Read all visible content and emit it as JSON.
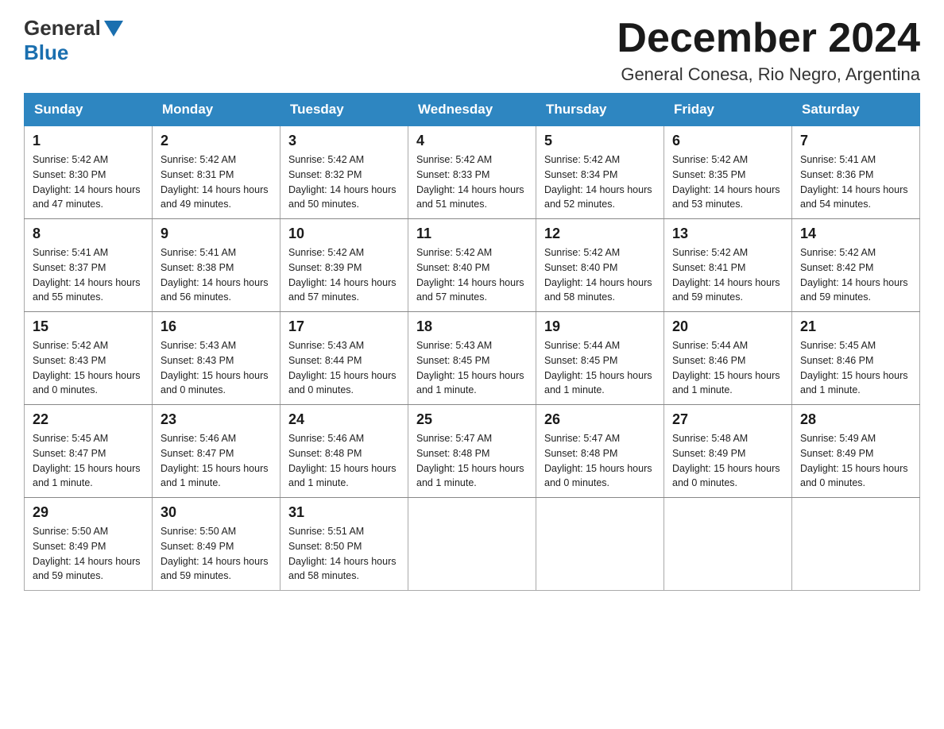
{
  "header": {
    "logo_general": "General",
    "logo_blue": "Blue",
    "title": "December 2024",
    "subtitle": "General Conesa, Rio Negro, Argentina"
  },
  "weekdays": [
    "Sunday",
    "Monday",
    "Tuesday",
    "Wednesday",
    "Thursday",
    "Friday",
    "Saturday"
  ],
  "weeks": [
    [
      {
        "day": "1",
        "sunrise": "5:42 AM",
        "sunset": "8:30 PM",
        "daylight": "14 hours and 47 minutes."
      },
      {
        "day": "2",
        "sunrise": "5:42 AM",
        "sunset": "8:31 PM",
        "daylight": "14 hours and 49 minutes."
      },
      {
        "day": "3",
        "sunrise": "5:42 AM",
        "sunset": "8:32 PM",
        "daylight": "14 hours and 50 minutes."
      },
      {
        "day": "4",
        "sunrise": "5:42 AM",
        "sunset": "8:33 PM",
        "daylight": "14 hours and 51 minutes."
      },
      {
        "day": "5",
        "sunrise": "5:42 AM",
        "sunset": "8:34 PM",
        "daylight": "14 hours and 52 minutes."
      },
      {
        "day": "6",
        "sunrise": "5:42 AM",
        "sunset": "8:35 PM",
        "daylight": "14 hours and 53 minutes."
      },
      {
        "day": "7",
        "sunrise": "5:41 AM",
        "sunset": "8:36 PM",
        "daylight": "14 hours and 54 minutes."
      }
    ],
    [
      {
        "day": "8",
        "sunrise": "5:41 AM",
        "sunset": "8:37 PM",
        "daylight": "14 hours and 55 minutes."
      },
      {
        "day": "9",
        "sunrise": "5:41 AM",
        "sunset": "8:38 PM",
        "daylight": "14 hours and 56 minutes."
      },
      {
        "day": "10",
        "sunrise": "5:42 AM",
        "sunset": "8:39 PM",
        "daylight": "14 hours and 57 minutes."
      },
      {
        "day": "11",
        "sunrise": "5:42 AM",
        "sunset": "8:40 PM",
        "daylight": "14 hours and 57 minutes."
      },
      {
        "day": "12",
        "sunrise": "5:42 AM",
        "sunset": "8:40 PM",
        "daylight": "14 hours and 58 minutes."
      },
      {
        "day": "13",
        "sunrise": "5:42 AM",
        "sunset": "8:41 PM",
        "daylight": "14 hours and 59 minutes."
      },
      {
        "day": "14",
        "sunrise": "5:42 AM",
        "sunset": "8:42 PM",
        "daylight": "14 hours and 59 minutes."
      }
    ],
    [
      {
        "day": "15",
        "sunrise": "5:42 AM",
        "sunset": "8:43 PM",
        "daylight": "15 hours and 0 minutes."
      },
      {
        "day": "16",
        "sunrise": "5:43 AM",
        "sunset": "8:43 PM",
        "daylight": "15 hours and 0 minutes."
      },
      {
        "day": "17",
        "sunrise": "5:43 AM",
        "sunset": "8:44 PM",
        "daylight": "15 hours and 0 minutes."
      },
      {
        "day": "18",
        "sunrise": "5:43 AM",
        "sunset": "8:45 PM",
        "daylight": "15 hours and 1 minute."
      },
      {
        "day": "19",
        "sunrise": "5:44 AM",
        "sunset": "8:45 PM",
        "daylight": "15 hours and 1 minute."
      },
      {
        "day": "20",
        "sunrise": "5:44 AM",
        "sunset": "8:46 PM",
        "daylight": "15 hours and 1 minute."
      },
      {
        "day": "21",
        "sunrise": "5:45 AM",
        "sunset": "8:46 PM",
        "daylight": "15 hours and 1 minute."
      }
    ],
    [
      {
        "day": "22",
        "sunrise": "5:45 AM",
        "sunset": "8:47 PM",
        "daylight": "15 hours and 1 minute."
      },
      {
        "day": "23",
        "sunrise": "5:46 AM",
        "sunset": "8:47 PM",
        "daylight": "15 hours and 1 minute."
      },
      {
        "day": "24",
        "sunrise": "5:46 AM",
        "sunset": "8:48 PM",
        "daylight": "15 hours and 1 minute."
      },
      {
        "day": "25",
        "sunrise": "5:47 AM",
        "sunset": "8:48 PM",
        "daylight": "15 hours and 1 minute."
      },
      {
        "day": "26",
        "sunrise": "5:47 AM",
        "sunset": "8:48 PM",
        "daylight": "15 hours and 0 minutes."
      },
      {
        "day": "27",
        "sunrise": "5:48 AM",
        "sunset": "8:49 PM",
        "daylight": "15 hours and 0 minutes."
      },
      {
        "day": "28",
        "sunrise": "5:49 AM",
        "sunset": "8:49 PM",
        "daylight": "15 hours and 0 minutes."
      }
    ],
    [
      {
        "day": "29",
        "sunrise": "5:50 AM",
        "sunset": "8:49 PM",
        "daylight": "14 hours and 59 minutes."
      },
      {
        "day": "30",
        "sunrise": "5:50 AM",
        "sunset": "8:49 PM",
        "daylight": "14 hours and 59 minutes."
      },
      {
        "day": "31",
        "sunrise": "5:51 AM",
        "sunset": "8:50 PM",
        "daylight": "14 hours and 58 minutes."
      },
      null,
      null,
      null,
      null
    ]
  ]
}
